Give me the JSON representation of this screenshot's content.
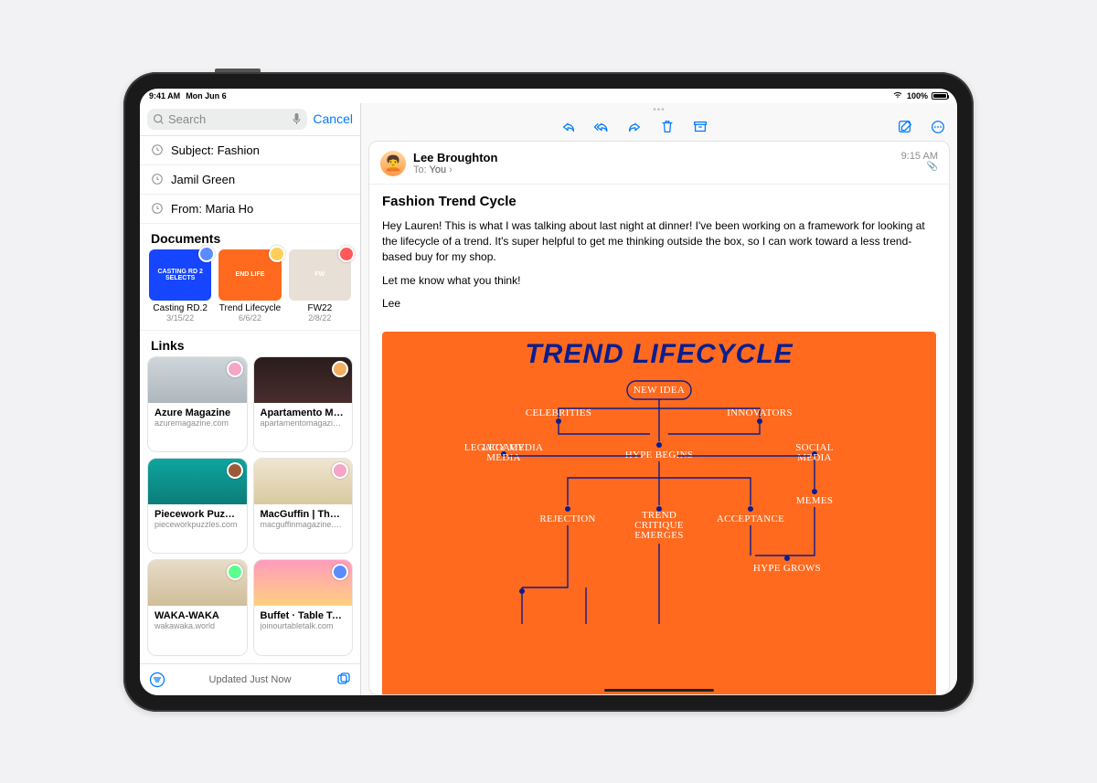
{
  "status": {
    "time": "9:41 AM",
    "date": "Mon Jun 6",
    "battery": "100%",
    "wifi_icon": "wifi"
  },
  "sidebar": {
    "search_placeholder": "Search",
    "cancel": "Cancel",
    "suggestions": [
      {
        "label": "Subject: Fashion"
      },
      {
        "label": "Jamil Green"
      },
      {
        "label": "From: Maria Ho"
      }
    ],
    "documents_heading": "Documents",
    "documents": [
      {
        "title": "Casting RD.2",
        "date": "3/15/22",
        "bg": "#1646ff",
        "thumb_text": "CASTING RD 2 SELECTS",
        "avatar": "#5b8cff"
      },
      {
        "title": "Trend Lifecycle",
        "date": "6/6/22",
        "bg": "#ff6a1f",
        "thumb_text": "END LIFE",
        "avatar": "#ffcf59"
      },
      {
        "title": "FW22",
        "date": "2/8/22",
        "bg": "#e8e0d6",
        "thumb_text": "FW",
        "avatar": "#ff5a5a"
      }
    ],
    "links_heading": "Links",
    "links": [
      {
        "title": "Azure Magazine",
        "domain": "azuremagazine.com",
        "bg": "linear-gradient(#cfd6da,#aeb7bd)",
        "avatar": "#f5a6c7"
      },
      {
        "title": "Apartamento Maga...",
        "domain": "apartamentomagazine.c...",
        "bg": "linear-gradient(#2a1c1c,#4a2d2d)",
        "avatar": "#f0b060"
      },
      {
        "title": "Piecework Puzzles",
        "domain": "pieceworkpuzzles.com",
        "bg": "linear-gradient(#0fa5a0,#0b7d79)",
        "avatar": "#9b5b3b"
      },
      {
        "title": "MacGuffin | The Lif...",
        "domain": "macguffinmagazine.com",
        "bg": "linear-gradient(#f0e6d2,#d8c99e)",
        "avatar": "#f5a6c7"
      },
      {
        "title": "WAKA-WAKA",
        "domain": "wakawaka.world",
        "bg": "linear-gradient(#e8dcc8,#d0be9a)",
        "avatar": "#5bff8c"
      },
      {
        "title": "Buffet · Table Talk",
        "domain": "joinourtabletalk.com",
        "bg": "linear-gradient(#ff9bbd,#ffd080)",
        "avatar": "#5b8cff"
      }
    ],
    "footer_status": "Updated Just Now"
  },
  "mail": {
    "from": "Lee Broughton",
    "to_label": "To:",
    "to": "You",
    "time": "9:15 AM",
    "subject": "Fashion Trend Cycle",
    "body_para1": "Hey Lauren! This is what I was talking about last night at dinner! I've been working on a framework for looking at the lifecycle of a trend. It's super helpful to get me thinking outside the box, so I can work toward a less trend-based buy for my shop.",
    "body_para2": "Let me know what you think!",
    "body_sign": "Lee"
  },
  "poster": {
    "title": "TREND LIFECYCLE",
    "nodes": {
      "new_idea": "NEW IDEA",
      "celebrities": "CELEBRITIES",
      "innovators": "INNOVATORS",
      "legacy_media": "LEGACY MEDIA",
      "hype_begins": "HYPE BEGINS",
      "social_media": "SOCIAL MEDIA",
      "memes": "MEMES",
      "rejection": "REJECTION",
      "trend_critique": "TREND CRITIQUE EMERGES",
      "acceptance": "ACCEPTANCE",
      "hype_grows": "HYPE GROWS"
    }
  }
}
